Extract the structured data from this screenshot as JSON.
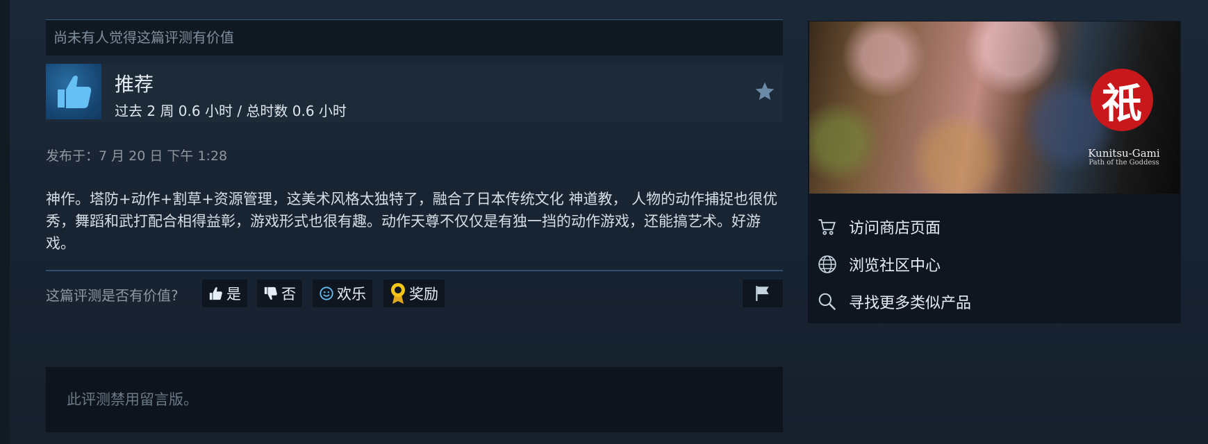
{
  "review": {
    "helpful_notice": "尚未有人觉得这篇评测有价值",
    "recommendation": "推荐",
    "hours": "过去 2 周 0.6 小时 / 总时数 0.6 小时",
    "posted": "发布于：7 月 20 日 下午 1:28",
    "body": "神作。塔防+动作+割草+资源管理，这美术风格太独特了，融合了日本传统文化 神道教， 人物的动作捕捉也很优秀，舞蹈和武打配合相得益彰，游戏形式也很有趣。动作天尊不仅仅是有独一挡的动作游戏，还能搞艺术。好游戏。",
    "vote_question": "这篇评测是否有价值?",
    "vote_buttons": {
      "yes": "是",
      "no": "否",
      "funny": "欢乐",
      "award": "奖励"
    },
    "comments_disabled": "此评测禁用留言版。"
  },
  "sidebar": {
    "banner": {
      "logo_glyph": "祇",
      "logo_title": "Kunitsu-Gami",
      "logo_subtitle": "Path of the Goddess"
    },
    "links": [
      {
        "label": "访问商店页面",
        "icon": "cart-icon"
      },
      {
        "label": "浏览社区中心",
        "icon": "globe-icon"
      },
      {
        "label": "寻找更多类似产品",
        "icon": "search-icon"
      }
    ]
  },
  "colors": {
    "background": "#1b2838",
    "accent_blue": "#2a6ea3",
    "award_gold": "#f5c518"
  }
}
